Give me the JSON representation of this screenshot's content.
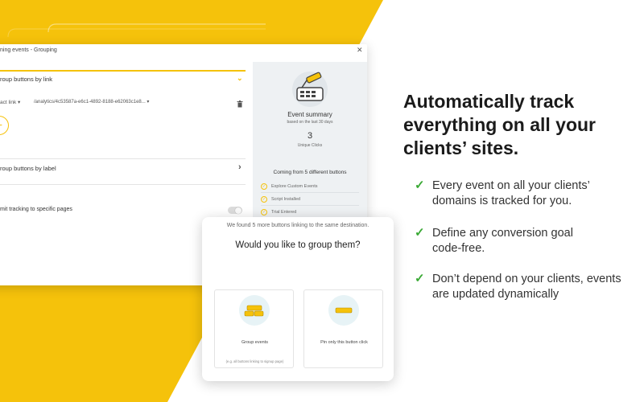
{
  "colors": {
    "accent": "#F5C20B",
    "check": "#3AA935",
    "panel": "#EEF1F3"
  },
  "window": {
    "title": "ning events - Grouping",
    "close_icon": "close-icon",
    "group_by_link": {
      "title": "roup buttons by link",
      "select_label": "act link ▾",
      "url_value": "/analytics/4c53587a-e6c1-4892-8188-e62063c1e8... ▾",
      "delete_icon": "trash-icon",
      "add_icon": "plus-icon"
    },
    "group_by_label": {
      "title": "roup buttons by label",
      "chevron_icon": "chevron-right-icon"
    },
    "limit_tracking": {
      "title": "mit tracking to specific pages"
    }
  },
  "summary": {
    "title": "Event summary",
    "subtitle": "based on the last 30 days",
    "count": "3",
    "count_label": "Unique Clicks",
    "coming_from": "Coming from 5 different buttons",
    "sources": [
      "Explore Custom Events",
      "Script Installed",
      "Trial Entered"
    ]
  },
  "dialog": {
    "subtitle": "We found 5 more buttons linking to the same destination.",
    "title": "Would you like to group them?",
    "options": [
      {
        "label": "Group events",
        "hint": "(e.g. all buttons linking to signup page)"
      },
      {
        "label": "Pin only this button click",
        "hint": ""
      }
    ]
  },
  "marketing": {
    "headline": [
      "Automatically track",
      "everything on all your",
      "clients’ sites."
    ],
    "features": [
      [
        "Every event on all your clients’",
        "domains is tracked for you."
      ],
      [
        "Define any conversion goal",
        "code-free."
      ],
      [
        "Don’t depend on your clients, events",
        "are updated dynamically"
      ]
    ],
    "check_icon": "check-icon"
  }
}
